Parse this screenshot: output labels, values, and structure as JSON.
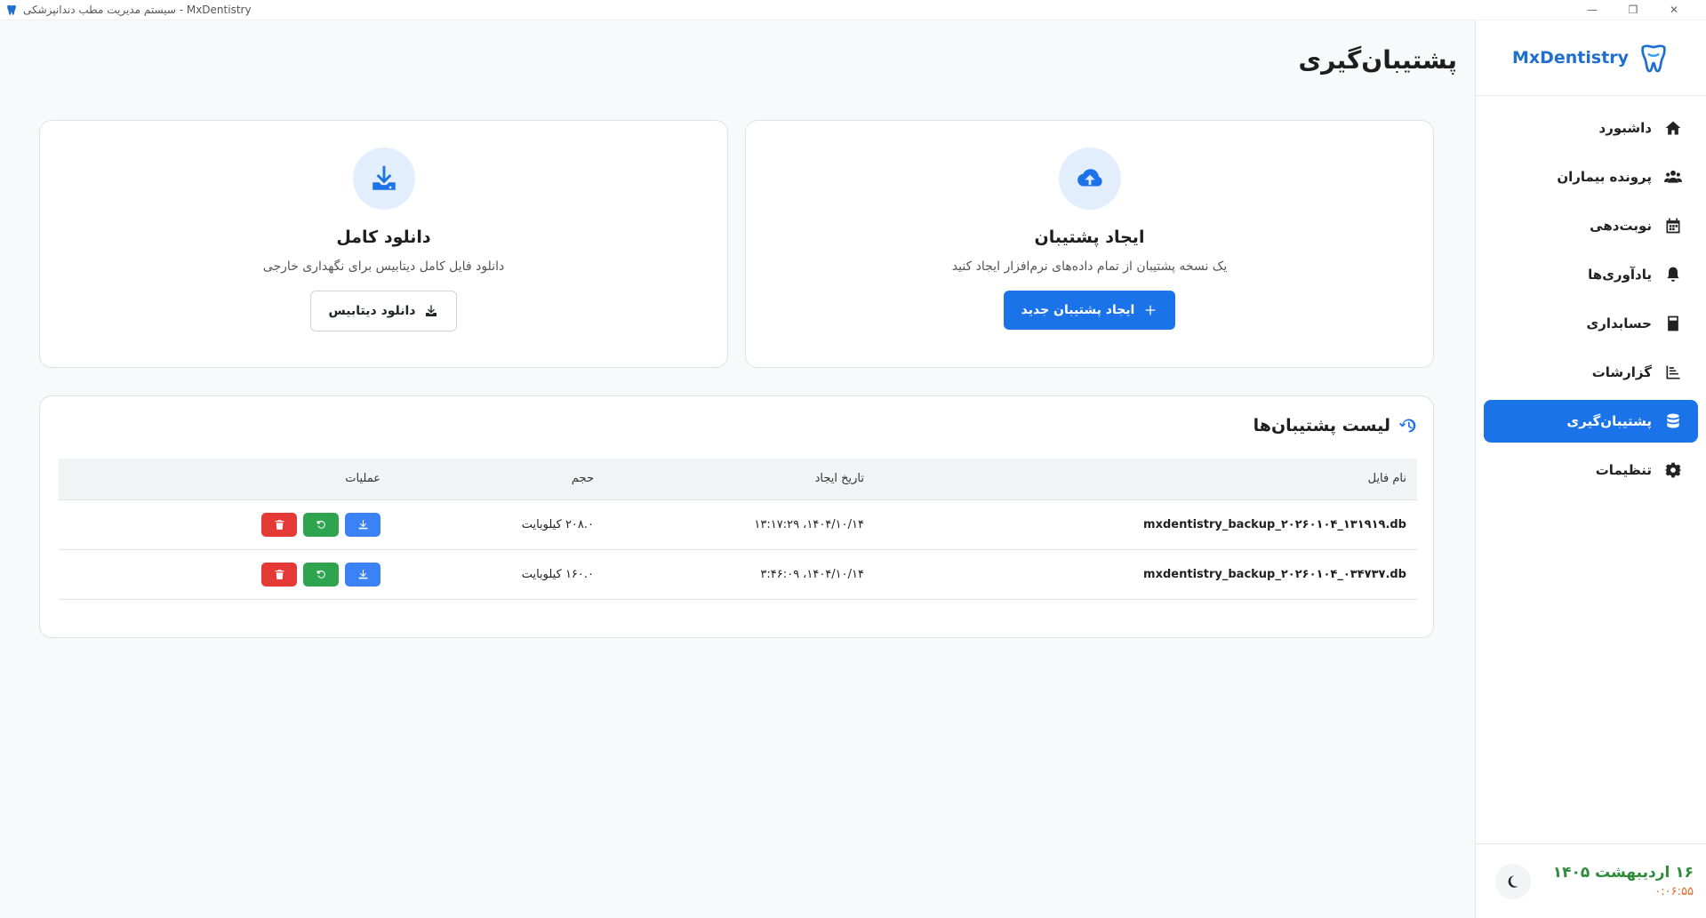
{
  "window": {
    "title": "سیستم مدیریت مطب دندانپزشکی - MxDentistry"
  },
  "sidebar": {
    "brand": "MxDentistry",
    "items": [
      {
        "label": "داشبورد",
        "icon": "home-icon"
      },
      {
        "label": "پرونده بیماران",
        "icon": "users-icon"
      },
      {
        "label": "نوبت‌دهی",
        "icon": "calendar-icon"
      },
      {
        "label": "یادآوری‌ها",
        "icon": "bell-icon"
      },
      {
        "label": "حسابداری",
        "icon": "calculator-icon"
      },
      {
        "label": "گزارشات",
        "icon": "chart-icon"
      },
      {
        "label": "پشتیبان‌گیری",
        "icon": "database-icon",
        "active": true
      },
      {
        "label": "تنظیمات",
        "icon": "gear-icon"
      }
    ],
    "date": "۱۶ اردیبهشت ۱۴۰۵",
    "time": "۰:۰۶:۵۵"
  },
  "page": {
    "title": "پشتیبان‌گیری"
  },
  "create_card": {
    "title": "ایجاد پشتیبان",
    "description": "یک نسخه پشتیبان از تمام داده‌های نرم‌افزار ایجاد کنید",
    "button": "ایجاد پشتیبان جدید"
  },
  "download_card": {
    "title": "دانلود کامل",
    "description": "دانلود فایل کامل دیتابیس برای نگهداری خارجی",
    "button": "دانلود دیتابیس"
  },
  "backups": {
    "title": "لیست پشتیبان‌ها",
    "columns": [
      "نام فایل",
      "تاریخ ایجاد",
      "حجم",
      "عملیات"
    ],
    "rows": [
      {
        "file": "mxdentistry_backup_۲۰۲۶۰۱۰۴_۱۳۱۹۱۹.db",
        "date": "۱۴۰۴/۱۰/۱۴، ۱۳:۱۷:۲۹",
        "size": "۲۰۸.۰ کیلوبایت"
      },
      {
        "file": "mxdentistry_backup_۲۰۲۶۰۱۰۴_۰۳۴۷۳۷.db",
        "date": "۱۴۰۴/۱۰/۱۴، ۳:۴۶:۰۹",
        "size": "۱۶۰.۰ کیلوبایت"
      }
    ]
  },
  "colors": {
    "primary": "#1a73e8",
    "success": "#2ea44f",
    "danger": "#e53935",
    "date_green": "#2e8b3a",
    "time_orange": "#e8692b"
  }
}
